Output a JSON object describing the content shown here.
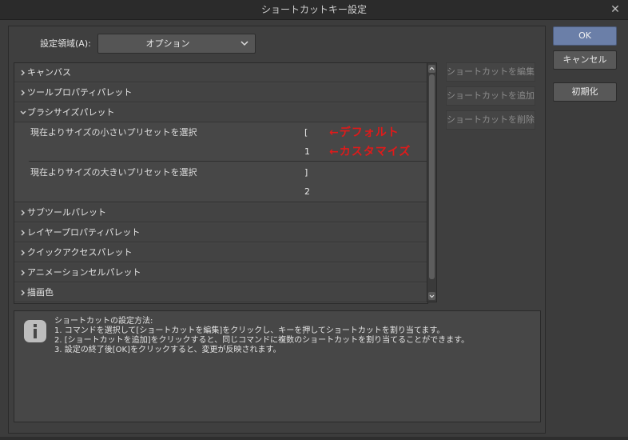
{
  "window": {
    "title": "ショートカットキー設定",
    "close_glyph": "✕"
  },
  "area": {
    "label": "設定領域(A):",
    "value": "オプション"
  },
  "tree": {
    "cat_canvas": "キャンバス",
    "cat_tool_property": "ツールプロパティパレット",
    "cat_brush_size": "ブラシサイズパレット",
    "item_smaller": {
      "label": "現在よりサイズの小さいプリセットを選択",
      "key1": "[",
      "key2": "1"
    },
    "item_larger": {
      "label": "現在よりサイズの大きいプリセットを選択",
      "key1": "]",
      "key2": "2"
    },
    "cat_sub_tool": "サブツールパレット",
    "cat_layer_property": "レイヤープロパティパレット",
    "cat_quick_access": "クイックアクセスパレット",
    "cat_animation_cel": "アニメーションセルパレット",
    "cat_draw_color": "描画色"
  },
  "side_buttons": {
    "edit": "ショートカットを編集",
    "add": "ショートカットを追加",
    "delete": "ショートカットを削除"
  },
  "main_buttons": {
    "ok": "OK",
    "cancel": "キャンセル",
    "reset": "初期化"
  },
  "annotations": {
    "default": "←デフォルト",
    "custom": "←カスタマイズ",
    "color": "#e01a1a"
  },
  "help": {
    "heading": "ショートカットの設定方法:",
    "line1": "1. コマンドを選択して[ショートカットを編集]をクリックし、キーを押してショートカットを割り当てます。",
    "line2": "2. [ショートカットを追加]をクリックすると、同じコマンドに複数のショートカットを割り当てることができます。",
    "line3": "3. 設定の終了後[OK]をクリックすると、変更が反映されます。"
  },
  "colors": {
    "ok_button": "#6b7fa8",
    "background": "#3c3c3c"
  }
}
